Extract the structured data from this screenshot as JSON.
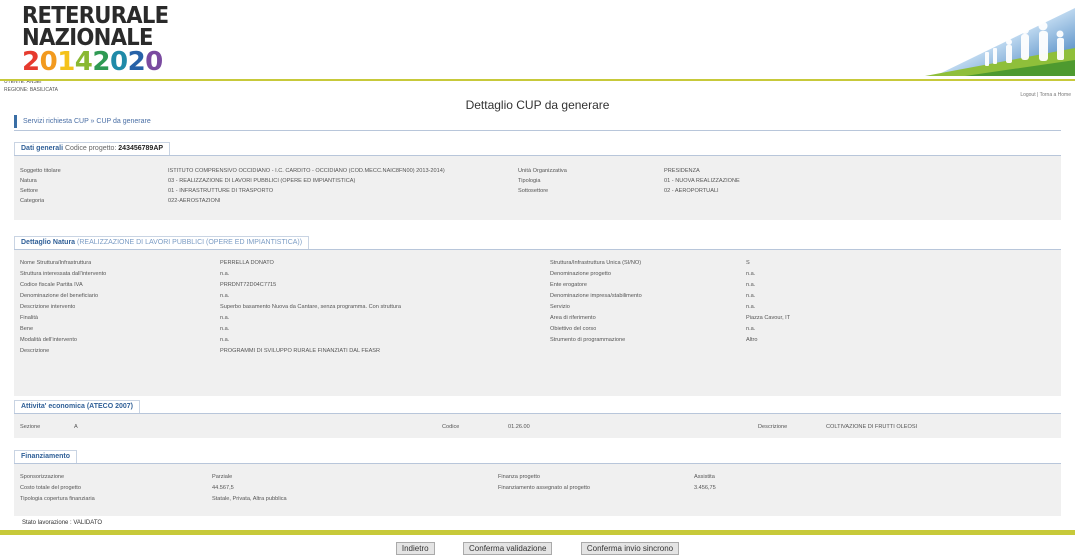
{
  "logo": {
    "line1": "RETERURALE",
    "line2": "NAZIONALE",
    "year_digits": [
      "2",
      "0",
      "1",
      "4",
      "2",
      "0",
      "2",
      "0"
    ]
  },
  "user": {
    "line1": "UTENTE: ANSEI",
    "line2": "REGIONE: BASILICATA"
  },
  "top_links": "Logout | Torna a Home",
  "page_title": "Dettaglio CUP da generare",
  "breadcrumb": "Servizi richiesta CUP » CUP da generare",
  "general": {
    "title": "Dati generali",
    "code_label": "Codice progetto: ",
    "code_value": "243456789AP",
    "rows": [
      [
        "Soggetto titolare",
        "ISTITUTO COMPRENSIVO OCCIDIANO - I.C. CARDITO - OCCIDIANO (COD.MECC.NAIC8FN00) 2013-2014)",
        "Unità Organizzativa",
        "PRESIDENZA"
      ],
      [
        "Natura",
        "03 - REALIZZAZIONE DI LAVORI PUBBLICI (OPERE ED IMPIANTISTICA)",
        "Tipologia",
        "01 - NUOVA REALIZZAZIONE"
      ],
      [
        "Settore",
        "01 - INFRASTRUTTURE DI TRASPORTO",
        "Sottosettore",
        "02 - AEROPORTUALI"
      ],
      [
        "Categoria",
        "022-AEROSTAZIONI",
        "",
        ""
      ]
    ]
  },
  "nature": {
    "title": "Dettaglio Natura",
    "subtitle": " (REALIZZAZIONE DI LAVORI PUBBLICI (OPERE ED IMPIANTISTICA))",
    "rows": [
      [
        "Nome Struttura/Infrastruttura",
        "PERRELLA DONATO",
        "Struttura/Infrastruttura Unica (SI/NO)",
        "S"
      ],
      [
        "Struttura interessata dall'intervento",
        "n.a.",
        "Denominazione progetto",
        "n.a."
      ],
      [
        "Codice fiscale Partita IVA",
        "PRRDNT72D04C7715",
        "Ente erogatore",
        "n.a."
      ],
      [
        "Denominazione del beneficiario",
        "n.a.",
        "Denominazione impresa/stabilimento",
        "n.a."
      ],
      [
        "Descrizione intervento",
        "Superbo basamento Nuova da Cantare, senza programma. Con struttura",
        "Servizio",
        "n.a."
      ],
      [
        "Finalità",
        "n.a.",
        "Area di riferimento",
        "Piazza Cavour, IT"
      ],
      [
        "Bene",
        "n.a.",
        "Obiettivo del corso",
        "n.a."
      ],
      [
        "Modalità dell'intervento",
        "n.a.",
        "Strumento di programmazione",
        "Altro"
      ],
      [
        "Descrizione",
        "PROGRAMMI DI SVILUPPO RURALE FINANZIATI DAL FEASR",
        "",
        ""
      ]
    ]
  },
  "ateco": {
    "title": "Attivita' economica (ATECO 2007)",
    "sezione_label": "Sezione",
    "sezione_value": "A",
    "codice_label": "Codice",
    "codice_value": "01.26.00",
    "descr_label": "Descrizione",
    "descr_value": "COLTIVAZIONE DI FRUTTI OLEOSI"
  },
  "financing": {
    "title": "Finanziamento",
    "rows": [
      [
        "Sponsorizzazione",
        "Parziale",
        "Finanza progetto",
        "Assistita"
      ],
      [
        "Costo totale del progetto",
        "44.567,5",
        "Finanziamento assegnato al progetto",
        "3.456,75"
      ],
      [
        "Tipologia copertura finanziaria",
        "Statale, Privata, Altra pubblica",
        "",
        ""
      ]
    ]
  },
  "status": "Stato lavorazione : VALIDATO",
  "buttons": {
    "back": "Indietro",
    "confirm_validation": "Conferma validazione",
    "confirm_sync": "Conferma invio sincrono"
  },
  "colors": {
    "accent": "#3a6ea5",
    "bar": "#c7c93a",
    "panel": "#f0f0f0"
  }
}
